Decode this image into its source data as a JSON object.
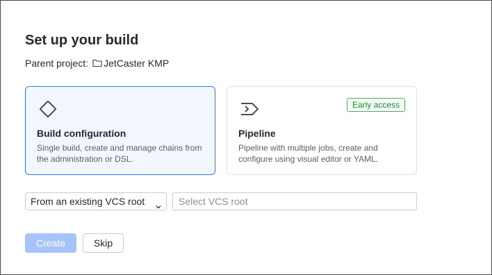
{
  "dialog": {
    "title": "Set up your build",
    "parent_label": "Parent project:",
    "parent_name": "JetCaster KMP"
  },
  "options": {
    "build": {
      "title": "Build configuration",
      "description": "Single build, create and manage chains from the administration or DSL.",
      "icon": "diamond-icon",
      "selected": true
    },
    "pipeline": {
      "title": "Pipeline",
      "description": "Pipeline with multiple jobs, create and configure using visual editor or YAML.",
      "icon": "pipeline-icon",
      "badge": "Early access",
      "selected": false
    }
  },
  "vcs": {
    "source_selected": "From an existing VCS root",
    "root_placeholder": "Select VCS root"
  },
  "actions": {
    "create_label": "Create",
    "skip_label": "Skip"
  },
  "colors": {
    "accent": "#3574f0",
    "selected_bg": "#f2f6fe",
    "badge_green": "#208a3c",
    "create_disabled": "#a7c4fa"
  }
}
